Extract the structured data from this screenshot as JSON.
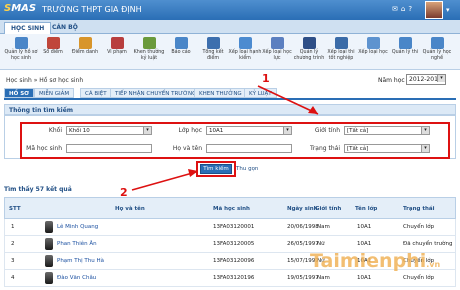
{
  "header": {
    "logo": "MAS",
    "school": "TRƯỜNG THPT GIA ĐỊNH"
  },
  "main_tabs": [
    "HỌC SINH",
    "CÁN BỘ"
  ],
  "ribbon": [
    {
      "label": "Quản lý hồ sơ học sinh",
      "color": "#4a86c8"
    },
    {
      "label": "Sổ điểm",
      "color": "#c0463a"
    },
    {
      "label": "Điểm danh",
      "color": "#d8952b"
    },
    {
      "label": "Vi phạm",
      "color": "#b83e3e"
    },
    {
      "label": "Khen thưởng kỷ luật",
      "color": "#6a9a3c"
    },
    {
      "label": "Báo cáo",
      "color": "#4a86c8"
    },
    {
      "label": "Tổng kết điểm",
      "color": "#3d6fae"
    },
    {
      "label": "Xếp loại hạnh kiểm",
      "color": "#4c8bd0"
    },
    {
      "label": "Xếp loại học lực",
      "color": "#5b7fc0"
    },
    {
      "label": "Quản lý chương trình",
      "color": "#2e4f87"
    },
    {
      "label": "Xếp loại thi tốt nghiệp",
      "color": "#3a6ba8"
    },
    {
      "label": "Xếp loại học",
      "color": "#5e93cf"
    },
    {
      "label": "Quản lý thi",
      "color": "#4a86c8"
    },
    {
      "label": "Quản lý học nghề",
      "color": "#4a86c8"
    }
  ],
  "breadcrumb": "Học sinh » Hồ sơ học sinh",
  "year": {
    "label": "Năm học",
    "value": "2012-2013"
  },
  "sub_tabs": [
    "HỒ SƠ",
    "MIỄN GIẢM",
    "CÁ BIỆT",
    "TIẾP NHẬN CHUYỂN TRƯỜNG",
    "KHEN THƯỞNG",
    "KỶ LUẬT"
  ],
  "filter": {
    "title": "Thông tin tìm kiếm",
    "khoi_label": "Khối",
    "khoi_value": "Khối 10",
    "lop_label": "Lớp học",
    "lop_value": "10A1",
    "gioitinh_label": "Giới tính",
    "gioitinh_value": "[Tất cả]",
    "mahs_label": "Mã học sinh",
    "hoten_label": "Họ và tên",
    "trangthai_label": "Trạng thái",
    "trangthai_value": "[Tất cả]",
    "search_btn": "Tìm kiếm",
    "collapse": "Thu gọn"
  },
  "annotations": [
    "1",
    "2"
  ],
  "results": {
    "found": "Tìm thấy 57 kết quả",
    "headers": [
      "STT",
      "Họ và tên",
      "Mã học sinh",
      "Ngày sinh",
      "Giới tính",
      "Tên lớp",
      "Trạng thái"
    ],
    "rows": [
      [
        "1",
        "Lê Minh Quang",
        "13FA03120001",
        "20/06/1998",
        "Nam",
        "10A1",
        "Chuyển lớp"
      ],
      [
        "2",
        "Phan Thiên Ân",
        "13FA03120005",
        "26/05/1997",
        "Nữ",
        "10A1",
        "Đã chuyển trường"
      ],
      [
        "3",
        "Phạm Thị Thu Hà",
        "13FA03120096",
        "15/07/1997",
        "Nữ",
        "10A1",
        "Chuyển lớp"
      ],
      [
        "4",
        "Đào Văn Châu",
        "13FA03120196",
        "19/05/1997",
        "Nam",
        "10A1",
        "Chuyển lớp"
      ]
    ]
  },
  "watermark": {
    "main": "Taimienphi",
    "tld": ".vn"
  },
  "colors": {
    "header_blue": "#2a6eb5",
    "highlight_red": "#d11"
  }
}
